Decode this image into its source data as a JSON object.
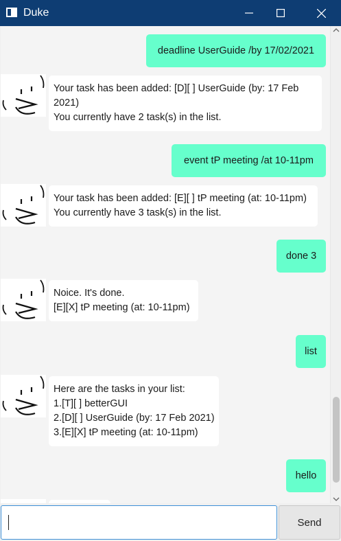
{
  "window": {
    "title": "Duke",
    "icons": {
      "app": "window-icon",
      "minimize": "minimize-icon",
      "maximize": "maximize-icon",
      "close": "close-icon"
    }
  },
  "colors": {
    "titlebar": "#0e3d73",
    "user_bubble": "#66ffcc",
    "duke_bubble": "#ffffff",
    "input_focus": "#3c8fd6"
  },
  "messages": [
    {
      "sender": "user",
      "lines": [
        "deadline UserGuide /by 17/02/2021"
      ]
    },
    {
      "sender": "duke",
      "lines": [
        "Your task has been added: [D][ ] UserGuide (by: 17 Feb",
        "2021)",
        "You currently have 2 task(s) in the list."
      ]
    },
    {
      "sender": "user",
      "lines": [
        "event tP meeting /at 10-11pm"
      ]
    },
    {
      "sender": "duke",
      "lines": [
        "Your task has been added: [E][ ] tP meeting (at: 10-11pm)",
        "You currently have 3 task(s) in the list."
      ]
    },
    {
      "sender": "user",
      "lines": [
        "done 3"
      ]
    },
    {
      "sender": "duke",
      "lines": [
        "Noice. It's done.",
        "[E][X] tP meeting (at: 10-11pm)"
      ]
    },
    {
      "sender": "user",
      "lines": [
        "list"
      ]
    },
    {
      "sender": "duke",
      "lines": [
        "Here are the tasks in your list:",
        "1.[T][ ] betterGUI",
        "2.[D][ ] UserGuide (by: 17 Feb 2021)",
        "3.[E][X] tP meeting (at: 10-11pm)"
      ]
    },
    {
      "sender": "user",
      "lines": [
        "hello"
      ]
    }
  ],
  "input": {
    "value": "",
    "placeholder": ""
  },
  "send_button": {
    "label": "Send"
  }
}
